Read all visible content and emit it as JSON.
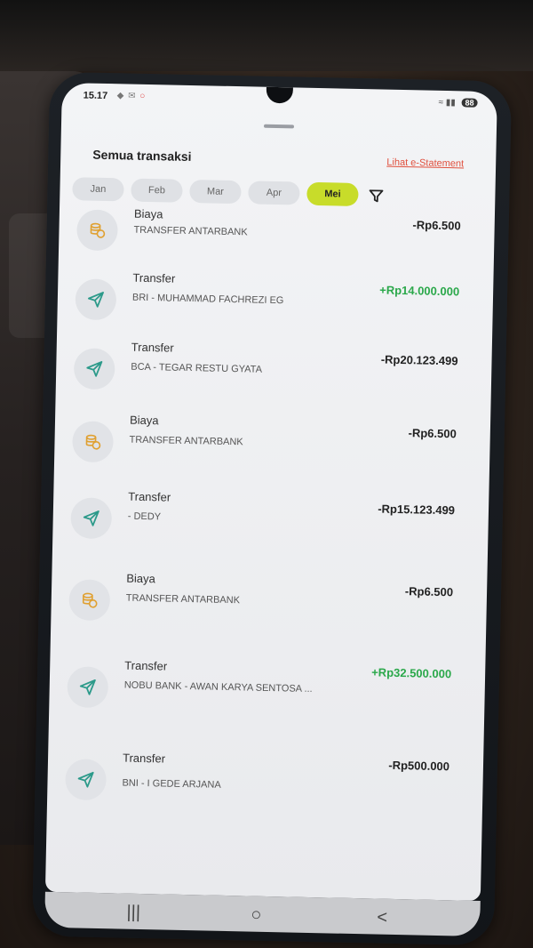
{
  "status_bar": {
    "time": "15.17",
    "battery": "88"
  },
  "header": {
    "title": "Semua transaksi",
    "statement_link": "Lihat e-Statement"
  },
  "months": [
    {
      "label": "Jan",
      "active": false
    },
    {
      "label": "Feb",
      "active": false
    },
    {
      "label": "Mar",
      "active": false
    },
    {
      "label": "Apr",
      "active": false
    },
    {
      "label": "Mei",
      "active": true
    }
  ],
  "transactions": [
    {
      "type": "Biaya",
      "desc": "TRANSFER ANTARBANK",
      "amount": "-Rp6.500",
      "positive": false,
      "icon": "coins-icon"
    },
    {
      "type": "Transfer",
      "desc": "BRI - MUHAMMAD FACHREZI EG",
      "amount": "+Rp14.000.000",
      "positive": true,
      "icon": "paper-plane-icon"
    },
    {
      "type": "Transfer",
      "desc": "BCA - TEGAR RESTU GYATA",
      "amount": "-Rp20.123.499",
      "positive": false,
      "icon": "paper-plane-icon"
    },
    {
      "type": "Biaya",
      "desc": "TRANSFER ANTARBANK",
      "amount": "-Rp6.500",
      "positive": false,
      "icon": "coins-icon"
    },
    {
      "type": "Transfer",
      "desc": "- DEDY",
      "amount": "-Rp15.123.499",
      "positive": false,
      "icon": "paper-plane-icon"
    },
    {
      "type": "Biaya",
      "desc": "TRANSFER ANTARBANK",
      "amount": "-Rp6.500",
      "positive": false,
      "icon": "coins-icon"
    },
    {
      "type": "Transfer",
      "desc": "NOBU BANK - AWAN KARYA SENTOSA ...",
      "amount": "+Rp32.500.000",
      "positive": true,
      "icon": "paper-plane-icon"
    },
    {
      "type": "Transfer",
      "desc": "BNI - I GEDE ARJANA",
      "amount": "-Rp500.000",
      "positive": false,
      "icon": "paper-plane-icon"
    }
  ],
  "nav": {
    "recents": "|||",
    "home": "○",
    "back": "<"
  },
  "colors": {
    "accent_active_month": "#c8dc2a",
    "positive_amount": "#2aa84a",
    "link": "#e0503e",
    "coin_icon": "#e0a030",
    "plane_icon": "#2c9a8a"
  }
}
